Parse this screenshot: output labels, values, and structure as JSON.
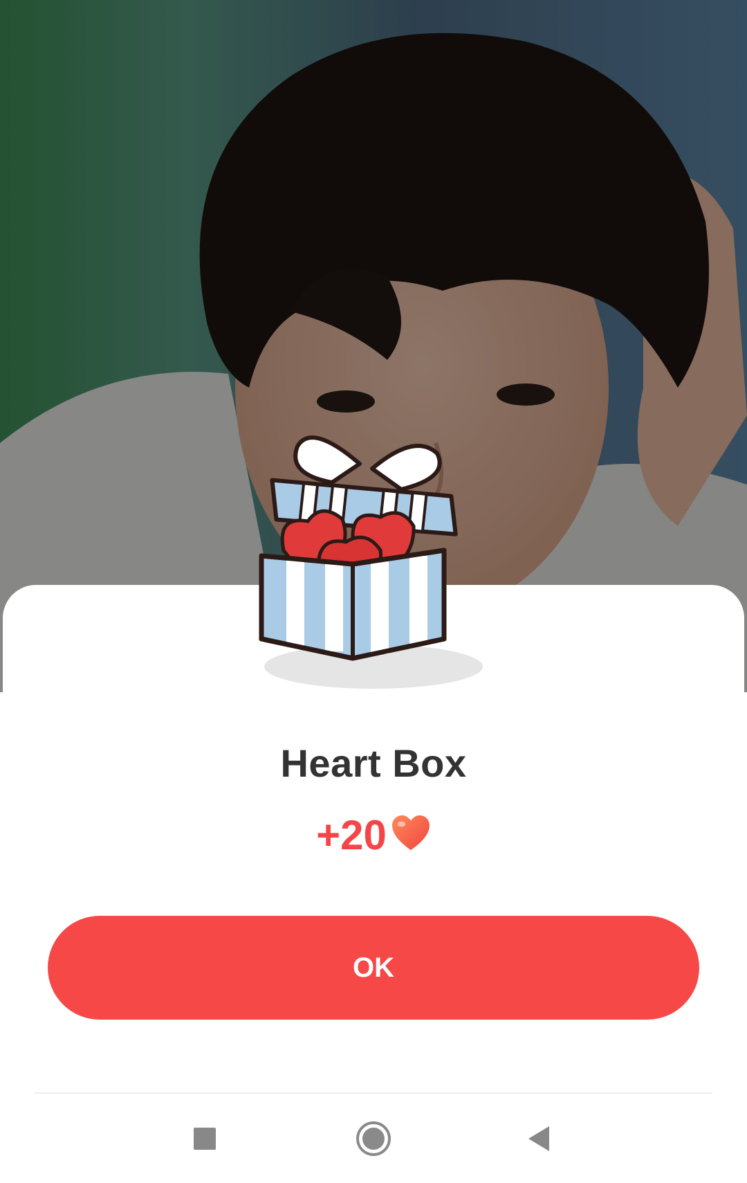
{
  "dialog": {
    "title": "Heart Box",
    "reward_amount": "+20",
    "reward_icon": "heart-icon",
    "ok_label": "OK",
    "gift_icon": "gift-box-icon"
  },
  "navbar": {
    "recents_icon": "square-recents-icon",
    "home_icon": "circle-home-icon",
    "back_icon": "triangle-back-icon"
  },
  "colors": {
    "accent": "#f74848",
    "reward_text": "#f44548",
    "title_text": "#333333",
    "gift_blue": "#a9cbe6",
    "gift_heart": "#e03a3a"
  }
}
